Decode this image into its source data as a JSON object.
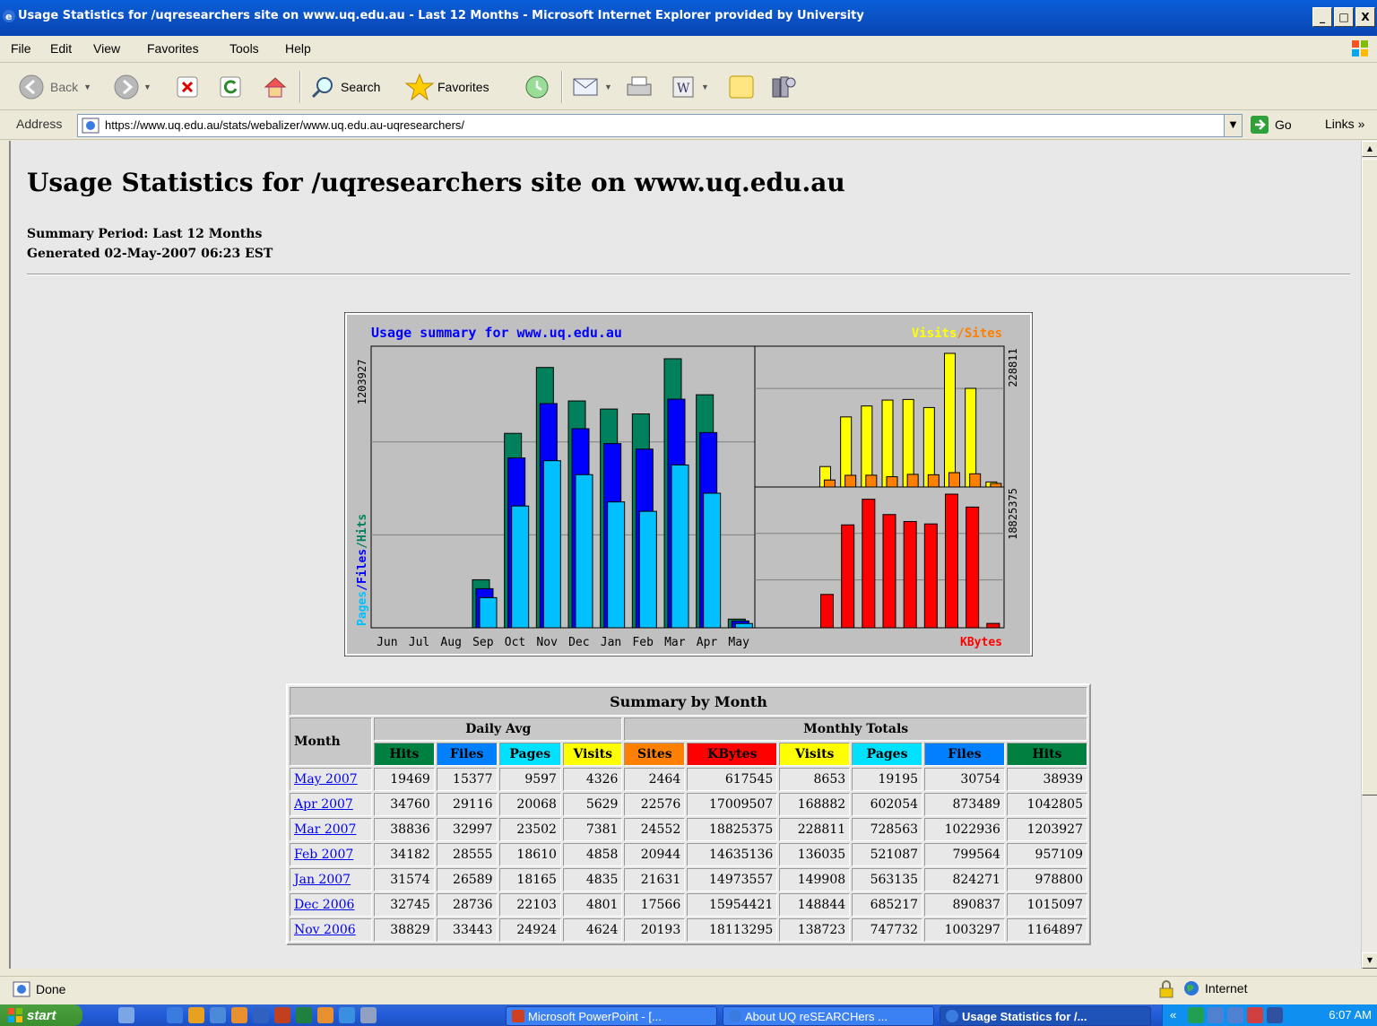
{
  "window": {
    "title": "Usage Statistics for /uqresearchers site on www.uq.edu.au - Last 12 Months - Microsoft Internet Explorer provided by University",
    "min_label": "_",
    "max_label": "□",
    "close_label": "X"
  },
  "menu": [
    "File",
    "Edit",
    "View",
    "Favorites",
    "Tools",
    "Help"
  ],
  "toolbar": {
    "back_label": "Back",
    "search_label": "Search",
    "favorites_label": "Favorites"
  },
  "address": {
    "label": "Address",
    "url": "https://www.uq.edu.au/stats/webalizer/www.uq.edu.au-uqresearchers/",
    "go_label": "Go",
    "links_label": "Links"
  },
  "page": {
    "title": "Usage Statistics for /uqresearchers site on www.uq.edu.au",
    "summary_period": "Summary Period: Last 12 Months",
    "generated": "Generated 02-May-2007 06:23 EST"
  },
  "chart_data": {
    "type": "bar",
    "title": "Usage summary for www.uq.edu.au",
    "categories": [
      "Jun",
      "Jul",
      "Aug",
      "Sep",
      "Oct",
      "Nov",
      "Dec",
      "Jan",
      "Feb",
      "Mar",
      "Apr",
      "May"
    ],
    "main_panel": {
      "ylabel_max": "1203927",
      "legend": [
        "Pages",
        "Files",
        "Hits"
      ],
      "series": [
        {
          "name": "Hits",
          "color": "#00805c",
          "values": [
            0,
            0,
            0,
            215000,
            870000,
            1164897,
            1015097,
            978800,
            957109,
            1203927,
            1042805,
            38939
          ]
        },
        {
          "name": "Files",
          "color": "#0000ff",
          "values": [
            0,
            0,
            0,
            175000,
            760000,
            1003297,
            890837,
            824271,
            799564,
            1022936,
            873489,
            30754
          ]
        },
        {
          "name": "Pages",
          "color": "#00c0ff",
          "values": [
            0,
            0,
            0,
            135000,
            545000,
            747732,
            685217,
            563135,
            521087,
            728563,
            602054,
            19195
          ]
        }
      ]
    },
    "visits_panel": {
      "ylabel_max": "228811",
      "legend": [
        "Visits",
        "Sites"
      ],
      "series": [
        {
          "name": "Visits",
          "color": "#ffff00",
          "values": [
            0,
            0,
            0,
            35000,
            120000,
            138723,
            148844,
            149908,
            136035,
            228811,
            168882,
            8653
          ]
        },
        {
          "name": "Sites",
          "color": "#ff8000",
          "values": [
            0,
            0,
            0,
            12000,
            20000,
            20193,
            17566,
            21631,
            20944,
            24552,
            22576,
            2464
          ]
        }
      ]
    },
    "kbytes_panel": {
      "ylabel_max": "18825375",
      "legend": [
        "KBytes"
      ],
      "series": [
        {
          "name": "KBytes",
          "color": "#ff0000",
          "values": [
            0,
            0,
            0,
            4700000,
            14500000,
            18113295,
            15954421,
            14973557,
            14635136,
            18825375,
            17009507,
            617545
          ]
        }
      ]
    }
  },
  "table": {
    "caption": "Summary by Month",
    "month_header": "Month",
    "daily_avg_header": "Daily Avg",
    "monthly_totals_header": "Monthly Totals",
    "columns": [
      "Hits",
      "Files",
      "Pages",
      "Visits",
      "Sites",
      "KBytes",
      "Visits",
      "Pages",
      "Files",
      "Hits"
    ],
    "rows": [
      [
        "May 2007",
        "19469",
        "15377",
        "9597",
        "4326",
        "2464",
        "617545",
        "8653",
        "19195",
        "30754",
        "38939"
      ],
      [
        "Apr 2007",
        "34760",
        "29116",
        "20068",
        "5629",
        "22576",
        "17009507",
        "168882",
        "602054",
        "873489",
        "1042805"
      ],
      [
        "Mar 2007",
        "38836",
        "32997",
        "23502",
        "7381",
        "24552",
        "18825375",
        "228811",
        "728563",
        "1022936",
        "1203927"
      ],
      [
        "Feb 2007",
        "34182",
        "28555",
        "18610",
        "4858",
        "20944",
        "14635136",
        "136035",
        "521087",
        "799564",
        "957109"
      ],
      [
        "Jan 2007",
        "31574",
        "26589",
        "18165",
        "4835",
        "21631",
        "14973557",
        "149908",
        "563135",
        "824271",
        "978800"
      ],
      [
        "Dec 2006",
        "32745",
        "28736",
        "22103",
        "4801",
        "17566",
        "15954421",
        "148844",
        "685217",
        "890837",
        "1015097"
      ],
      [
        "Nov 2006",
        "38829",
        "33443",
        "24924",
        "4624",
        "20193",
        "18113295",
        "138723",
        "747732",
        "1003297",
        "1164897"
      ]
    ]
  },
  "status": {
    "text": "Done",
    "zone": "Internet"
  },
  "taskbar": {
    "start_label": "start",
    "tasks": [
      "Microsoft PowerPoint - [...",
      "About UQ reSEARCHers ...",
      "Usage Statistics for /..."
    ],
    "clock": "6:07 AM"
  },
  "colors": {
    "hits": "#008040",
    "files": "#0080ff",
    "pages": "#00e0ff",
    "visits": "#ffff00",
    "sites": "#ff8000",
    "kbytes": "#ff0000"
  }
}
